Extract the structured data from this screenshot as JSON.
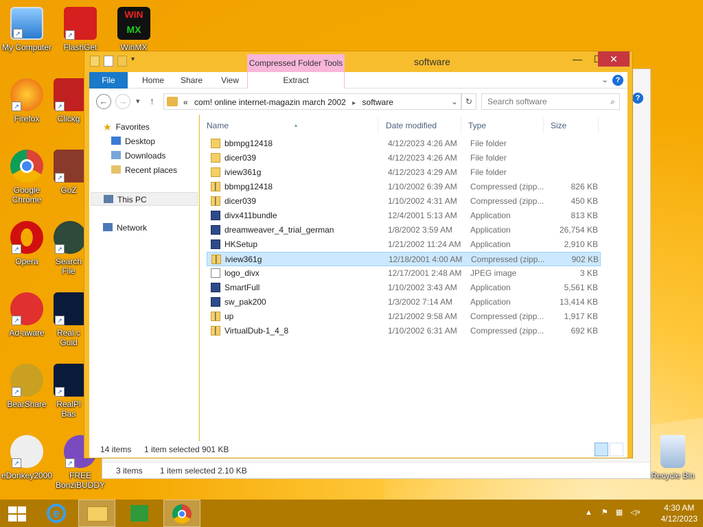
{
  "desktop": {
    "icons": [
      {
        "label": "My Computer",
        "icon": "computer-icon"
      },
      {
        "label": "FlashGet",
        "icon": "flashget-icon"
      },
      {
        "label": "WinMX",
        "icon": "winmx-icon"
      },
      {
        "label": "Firefox",
        "icon": "firefox-icon"
      },
      {
        "label": "Clickg",
        "icon": "clickgamer-icon"
      },
      {
        "label": "Google Chrome",
        "icon": "chrome-icon"
      },
      {
        "label": "GoZ",
        "icon": "gozilla-icon"
      },
      {
        "label": "Opera",
        "icon": "opera-icon"
      },
      {
        "label": "Search File",
        "icon": "search-file-icon"
      },
      {
        "label": "Ad-aware",
        "icon": "adaware-icon"
      },
      {
        "label": "Real.c Guid",
        "icon": "real-guide-icon"
      },
      {
        "label": "BearShare",
        "icon": "bearshare-icon"
      },
      {
        "label": "RealPl Bas",
        "icon": "realplayer-icon"
      },
      {
        "label": "eDonkey2000",
        "icon": "edonkey-icon"
      },
      {
        "label": "FREE BonziBUDDY",
        "icon": "bonzibuddy-icon"
      },
      {
        "label": "Recycle Bin",
        "icon": "recycle-bin-icon"
      }
    ]
  },
  "back_window": {
    "status_items": "3 items",
    "status_selected": "1 item selected  2.10 KB"
  },
  "window": {
    "title": "software",
    "context_tab": "Compressed Folder Tools",
    "ribbon_tabs": [
      "File",
      "Home",
      "Share",
      "View",
      "Extract"
    ],
    "address": {
      "overflow": "«",
      "crumb1": "com! online internet-magazin march 2002",
      "crumb2": "software"
    },
    "search_placeholder": "Search software",
    "nav": {
      "favorites": "Favorites",
      "desktop": "Desktop",
      "downloads": "Downloads",
      "recent": "Recent places",
      "thispc": "This PC",
      "network": "Network"
    },
    "columns": {
      "name": "Name",
      "date": "Date modified",
      "type": "Type",
      "size": "Size"
    },
    "files": [
      {
        "name": "bbmpg12418",
        "date": "4/12/2023 4:26 AM",
        "type": "File folder",
        "size": "",
        "icon": "folder-icon"
      },
      {
        "name": "dicer039",
        "date": "4/12/2023 4:26 AM",
        "type": "File folder",
        "size": "",
        "icon": "folder-icon"
      },
      {
        "name": "iview361g",
        "date": "4/12/2023 4:29 AM",
        "type": "File folder",
        "size": "",
        "icon": "folder-icon"
      },
      {
        "name": "bbmpg12418",
        "date": "1/10/2002 6:39 AM",
        "type": "Compressed (zipp...",
        "size": "826 KB",
        "icon": "zip-folder-icon"
      },
      {
        "name": "dicer039",
        "date": "1/10/2002 4:31 AM",
        "type": "Compressed (zipp...",
        "size": "450 KB",
        "icon": "zip-folder-icon"
      },
      {
        "name": "divx411bundle",
        "date": "12/4/2001 5:13 AM",
        "type": "Application",
        "size": "813 KB",
        "icon": "application-icon"
      },
      {
        "name": "dreamweaver_4_trial_german",
        "date": "1/8/2002 3:59 AM",
        "type": "Application",
        "size": "26,754 KB",
        "icon": "application-icon"
      },
      {
        "name": "HKSetup",
        "date": "1/21/2002 11:24 AM",
        "type": "Application",
        "size": "2,910 KB",
        "icon": "application-icon"
      },
      {
        "name": "iview361g",
        "date": "12/18/2001 4:00 AM",
        "type": "Compressed (zipp...",
        "size": "902 KB",
        "icon": "zip-folder-icon"
      },
      {
        "name": "logo_divx",
        "date": "12/17/2001 2:48 AM",
        "type": "JPEG image",
        "size": "3 KB",
        "icon": "image-file-icon"
      },
      {
        "name": "SmartFull",
        "date": "1/10/2002 3:43 AM",
        "type": "Application",
        "size": "5,561 KB",
        "icon": "application-icon"
      },
      {
        "name": "sw_pak200",
        "date": "1/3/2002 7:14 AM",
        "type": "Application",
        "size": "13,414 KB",
        "icon": "application-icon"
      },
      {
        "name": "up",
        "date": "1/21/2002 9:58 AM",
        "type": "Compressed (zipp...",
        "size": "1,917 KB",
        "icon": "zip-folder-icon"
      },
      {
        "name": "VirtualDub-1_4_8",
        "date": "1/10/2002 6:31 AM",
        "type": "Compressed (zipp...",
        "size": "692 KB",
        "icon": "zip-folder-icon"
      }
    ],
    "status_items": "14 items",
    "status_selected": "1 item selected  901 KB"
  },
  "taskbar": {
    "time": "4:30 AM",
    "date": "4/12/2023"
  }
}
